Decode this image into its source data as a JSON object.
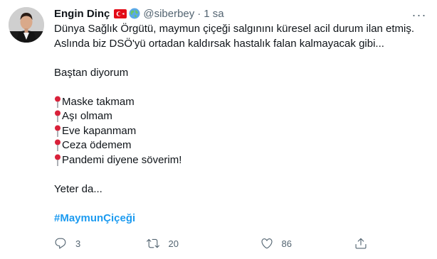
{
  "author": {
    "name": "Engin Dinç",
    "handle": "@siberbey",
    "separator": "·",
    "time": "1 sa",
    "emoji": [
      "turkey-flag-icon",
      "globe-icon"
    ]
  },
  "tweet": {
    "line1": "Dünya Sağlık Örgütü, maymun çiçeği salgınını küresel acil durum ilan etmiş.",
    "line2": "Aslında biz DSÖ'yü ortadan kaldırsak hastalık falan kalmayacak gibi...",
    "intro": "Baştan diyorum",
    "list": [
      "Maske takmam",
      "Aşı olmam",
      "Eve kapanmam",
      "Ceza ödemem",
      "Pandemi diyene söverim!"
    ],
    "outro": "Yeter da...",
    "hashtag": "#MaymunÇiçeği"
  },
  "actions": {
    "replies": "3",
    "retweets": "20",
    "likes": "86"
  },
  "colors": {
    "link": "#1d9bf0",
    "secondary": "#536471",
    "text": "#0f1419",
    "pin": "#d9213a"
  }
}
